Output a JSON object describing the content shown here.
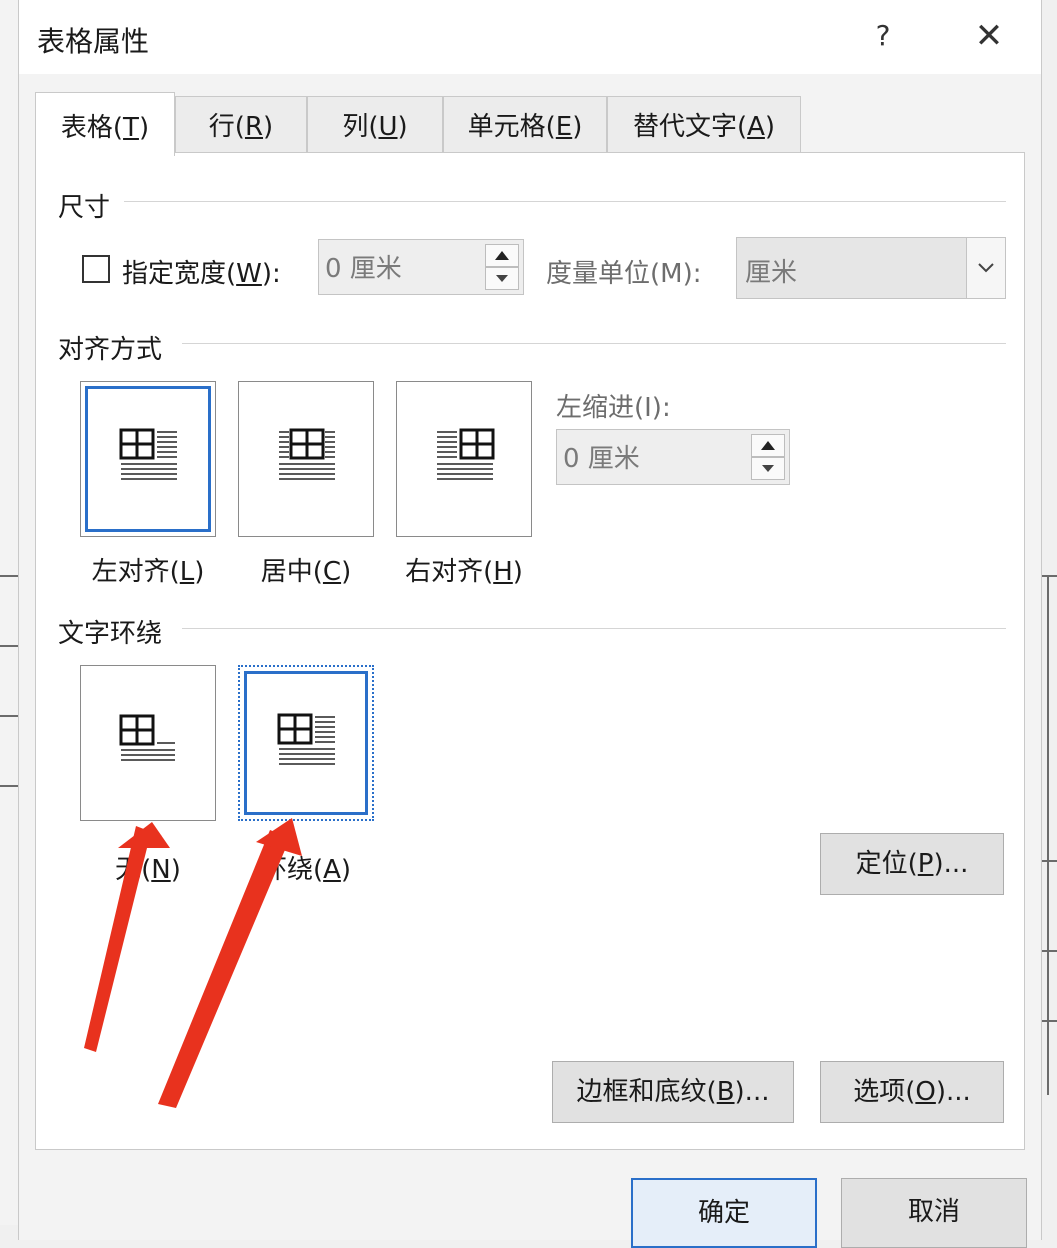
{
  "dialog": {
    "title": "表格属性",
    "help": "?",
    "close": "✕"
  },
  "tabs": [
    {
      "label": "表格(",
      "key": "T",
      "end": ")",
      "active": true
    },
    {
      "label": "行(",
      "key": "R",
      "end": ")"
    },
    {
      "label": "列(",
      "key": "U",
      "end": ")"
    },
    {
      "label": "单元格(",
      "key": "E",
      "end": ")"
    },
    {
      "label": "替代文字(",
      "key": "A",
      "end": ")"
    }
  ],
  "size": {
    "section": "尺寸",
    "width_label_pre": "指定宽度(",
    "width_label_key": "W",
    "width_label_post": "):",
    "width_value": "0 厘米",
    "unit_label": "度量单位(M):",
    "unit_value": "厘米"
  },
  "alignment": {
    "section": "对齐方式",
    "options": [
      {
        "pre": "左对齐(",
        "key": "L",
        "post": ")",
        "selected": true
      },
      {
        "pre": "居中(",
        "key": "C",
        "post": ")"
      },
      {
        "pre": "右对齐(",
        "key": "H",
        "post": ")"
      }
    ],
    "indent_label": "左缩进(I):",
    "indent_value": "0 厘米"
  },
  "wrap": {
    "section": "文字环绕",
    "options": [
      {
        "pre": "无(",
        "key": "N",
        "post": ")"
      },
      {
        "pre": "环绕(",
        "key": "A",
        "post": ")",
        "selected": true
      }
    ]
  },
  "buttons": {
    "position_pre": "定位(",
    "position_key": "P",
    "position_post": ")...",
    "borders_pre": "边框和底纹(",
    "borders_key": "B",
    "borders_post": ")...",
    "options_pre": "选项(",
    "options_key": "O",
    "options_post": ")...",
    "ok": "确定",
    "cancel": "取消"
  },
  "colors": {
    "accent": "#2a6fc9",
    "arrow": "#e8321e"
  }
}
